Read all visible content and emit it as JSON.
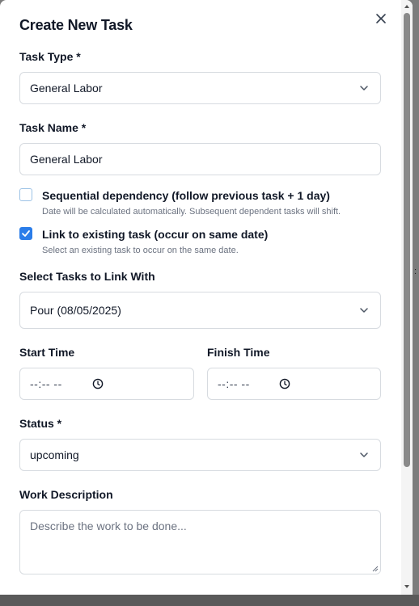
{
  "modal": {
    "title": "Create New Task"
  },
  "task_type": {
    "label": "Task Type *",
    "value": "General Labor"
  },
  "task_name": {
    "label": "Task Name *",
    "value": "General Labor"
  },
  "sequential": {
    "checked": false,
    "label": "Sequential dependency (follow previous task + 1 day)",
    "help": "Date will be calculated automatically. Subsequent dependent tasks will shift."
  },
  "link_existing": {
    "checked": true,
    "label": "Link to existing task (occur on same date)",
    "help": "Select an existing task to occur on the same date."
  },
  "link_tasks": {
    "label": "Select Tasks to Link With",
    "value": "Pour (08/05/2025)"
  },
  "start_time": {
    "label": "Start Time",
    "value": "--:-- --"
  },
  "finish_time": {
    "label": "Finish Time",
    "value": "--:-- --"
  },
  "status": {
    "label": "Status *",
    "value": "upcoming"
  },
  "work_description": {
    "label": "Work Description",
    "placeholder": "Describe the work to be done..."
  },
  "colors": {
    "accent": "#2b7de9",
    "border": "#d7dbe0"
  },
  "icons": [
    "close-icon",
    "chevron-down-icon",
    "check-icon",
    "clock-icon",
    "resize-grip-icon"
  ]
}
